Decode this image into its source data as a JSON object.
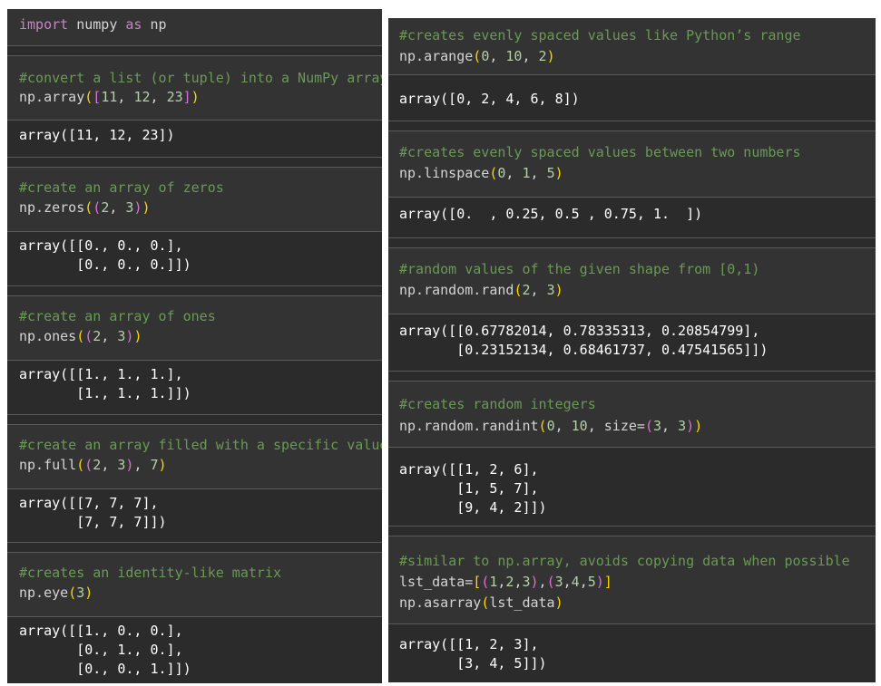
{
  "left_panel": {
    "cells": [
      {
        "code": [
          "import numpy as np"
        ],
        "output": []
      },
      {
        "code": [
          "#convert a list (or tuple) into a NumPy array",
          "np.array([11, 12, 23])"
        ],
        "output": [
          "array([11, 12, 23])"
        ]
      },
      {
        "code": [
          "#create an array of zeros",
          "np.zeros((2, 3))"
        ],
        "output": [
          "array([[0., 0., 0.],",
          "       [0., 0., 0.]])"
        ]
      },
      {
        "code": [
          "#create an array of ones",
          "np.ones((2, 3))"
        ],
        "output": [
          "array([[1., 1., 1.],",
          "       [1., 1., 1.]])"
        ]
      },
      {
        "code": [
          "#create an array filled with a specific value",
          "np.full((2, 3), 7)"
        ],
        "output": [
          "array([[7, 7, 7],",
          "       [7, 7, 7]])"
        ]
      },
      {
        "code": [
          "#creates an identity-like matrix",
          "np.eye(3)"
        ],
        "output": [
          "array([[1., 0., 0.],",
          "       [0., 1., 0.],",
          "       [0., 0., 1.]])"
        ]
      }
    ]
  },
  "right_panel": {
    "cells": [
      {
        "code": [
          "#creates evenly spaced values like Python’s range",
          "np.arange(0, 10, 2)"
        ],
        "output": [
          "array([0, 2, 4, 6, 8])"
        ]
      },
      {
        "code": [
          "#creates evenly spaced values between two numbers",
          "np.linspace(0, 1, 5)"
        ],
        "output": [
          "array([0.  , 0.25, 0.5 , 0.75, 1.  ])"
        ]
      },
      {
        "code": [
          "#random values of the given shape from [0,1)",
          "np.random.rand(2, 3)"
        ],
        "output": [
          "array([[0.67782014, 0.78335313, 0.20854799],",
          "       [0.23152134, 0.68461737, 0.47541565]])"
        ]
      },
      {
        "code": [
          "#creates random integers",
          "np.random.randint(0, 10, size=(3, 3))"
        ],
        "output": [
          "array([[1, 2, 6],",
          "       [1, 5, 7],",
          "       [9, 4, 2]])"
        ]
      },
      {
        "code": [
          "#similar to np.array, avoids copying data when possible",
          "lst_data=[(1,2,3),(3,4,5)]",
          "np.asarray(lst_data)"
        ],
        "output": [
          "array([[1, 2, 3],",
          "       [3, 4, 5]])"
        ]
      }
    ]
  },
  "colors": {
    "panel_bg": "#2b2b2b",
    "cell_bg": "#333333",
    "comment": "#6a9955",
    "code_text": "#d4d4d4",
    "number": "#b5cea8",
    "bracket_outer": "#ffd700",
    "bracket_inner": "#da70d6",
    "output_text": "#ffffff"
  }
}
